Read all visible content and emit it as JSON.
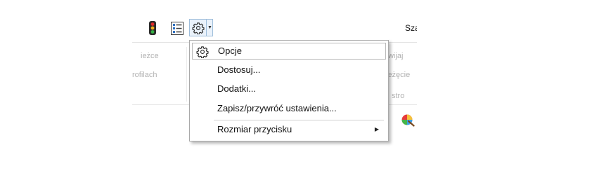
{
  "toolbar": {
    "title_fragment": "Sza",
    "icons": [
      "traffic-light-icon",
      "list-icon",
      "gear-icon",
      "chevron-down-icon"
    ]
  },
  "ribbon": {
    "left": [
      "ieżce",
      "rofilach"
    ],
    "right": [
      "wijaj",
      "ieżęcie",
      "stro"
    ]
  },
  "options_menu": {
    "items": [
      {
        "label": "Opcje",
        "icon": "gear-icon"
      },
      {
        "label": "Dostosuj..."
      },
      {
        "label": "Dodatki..."
      },
      {
        "label": "Zapisz/przywróć ustawienia..."
      },
      {
        "label": "Rozmiar przycisku",
        "has_submenu": true
      }
    ]
  },
  "colors": {
    "accent_border": "#9fbedb",
    "accent_fill": "#eaf2fb",
    "menu_border": "#a9a9a9"
  }
}
